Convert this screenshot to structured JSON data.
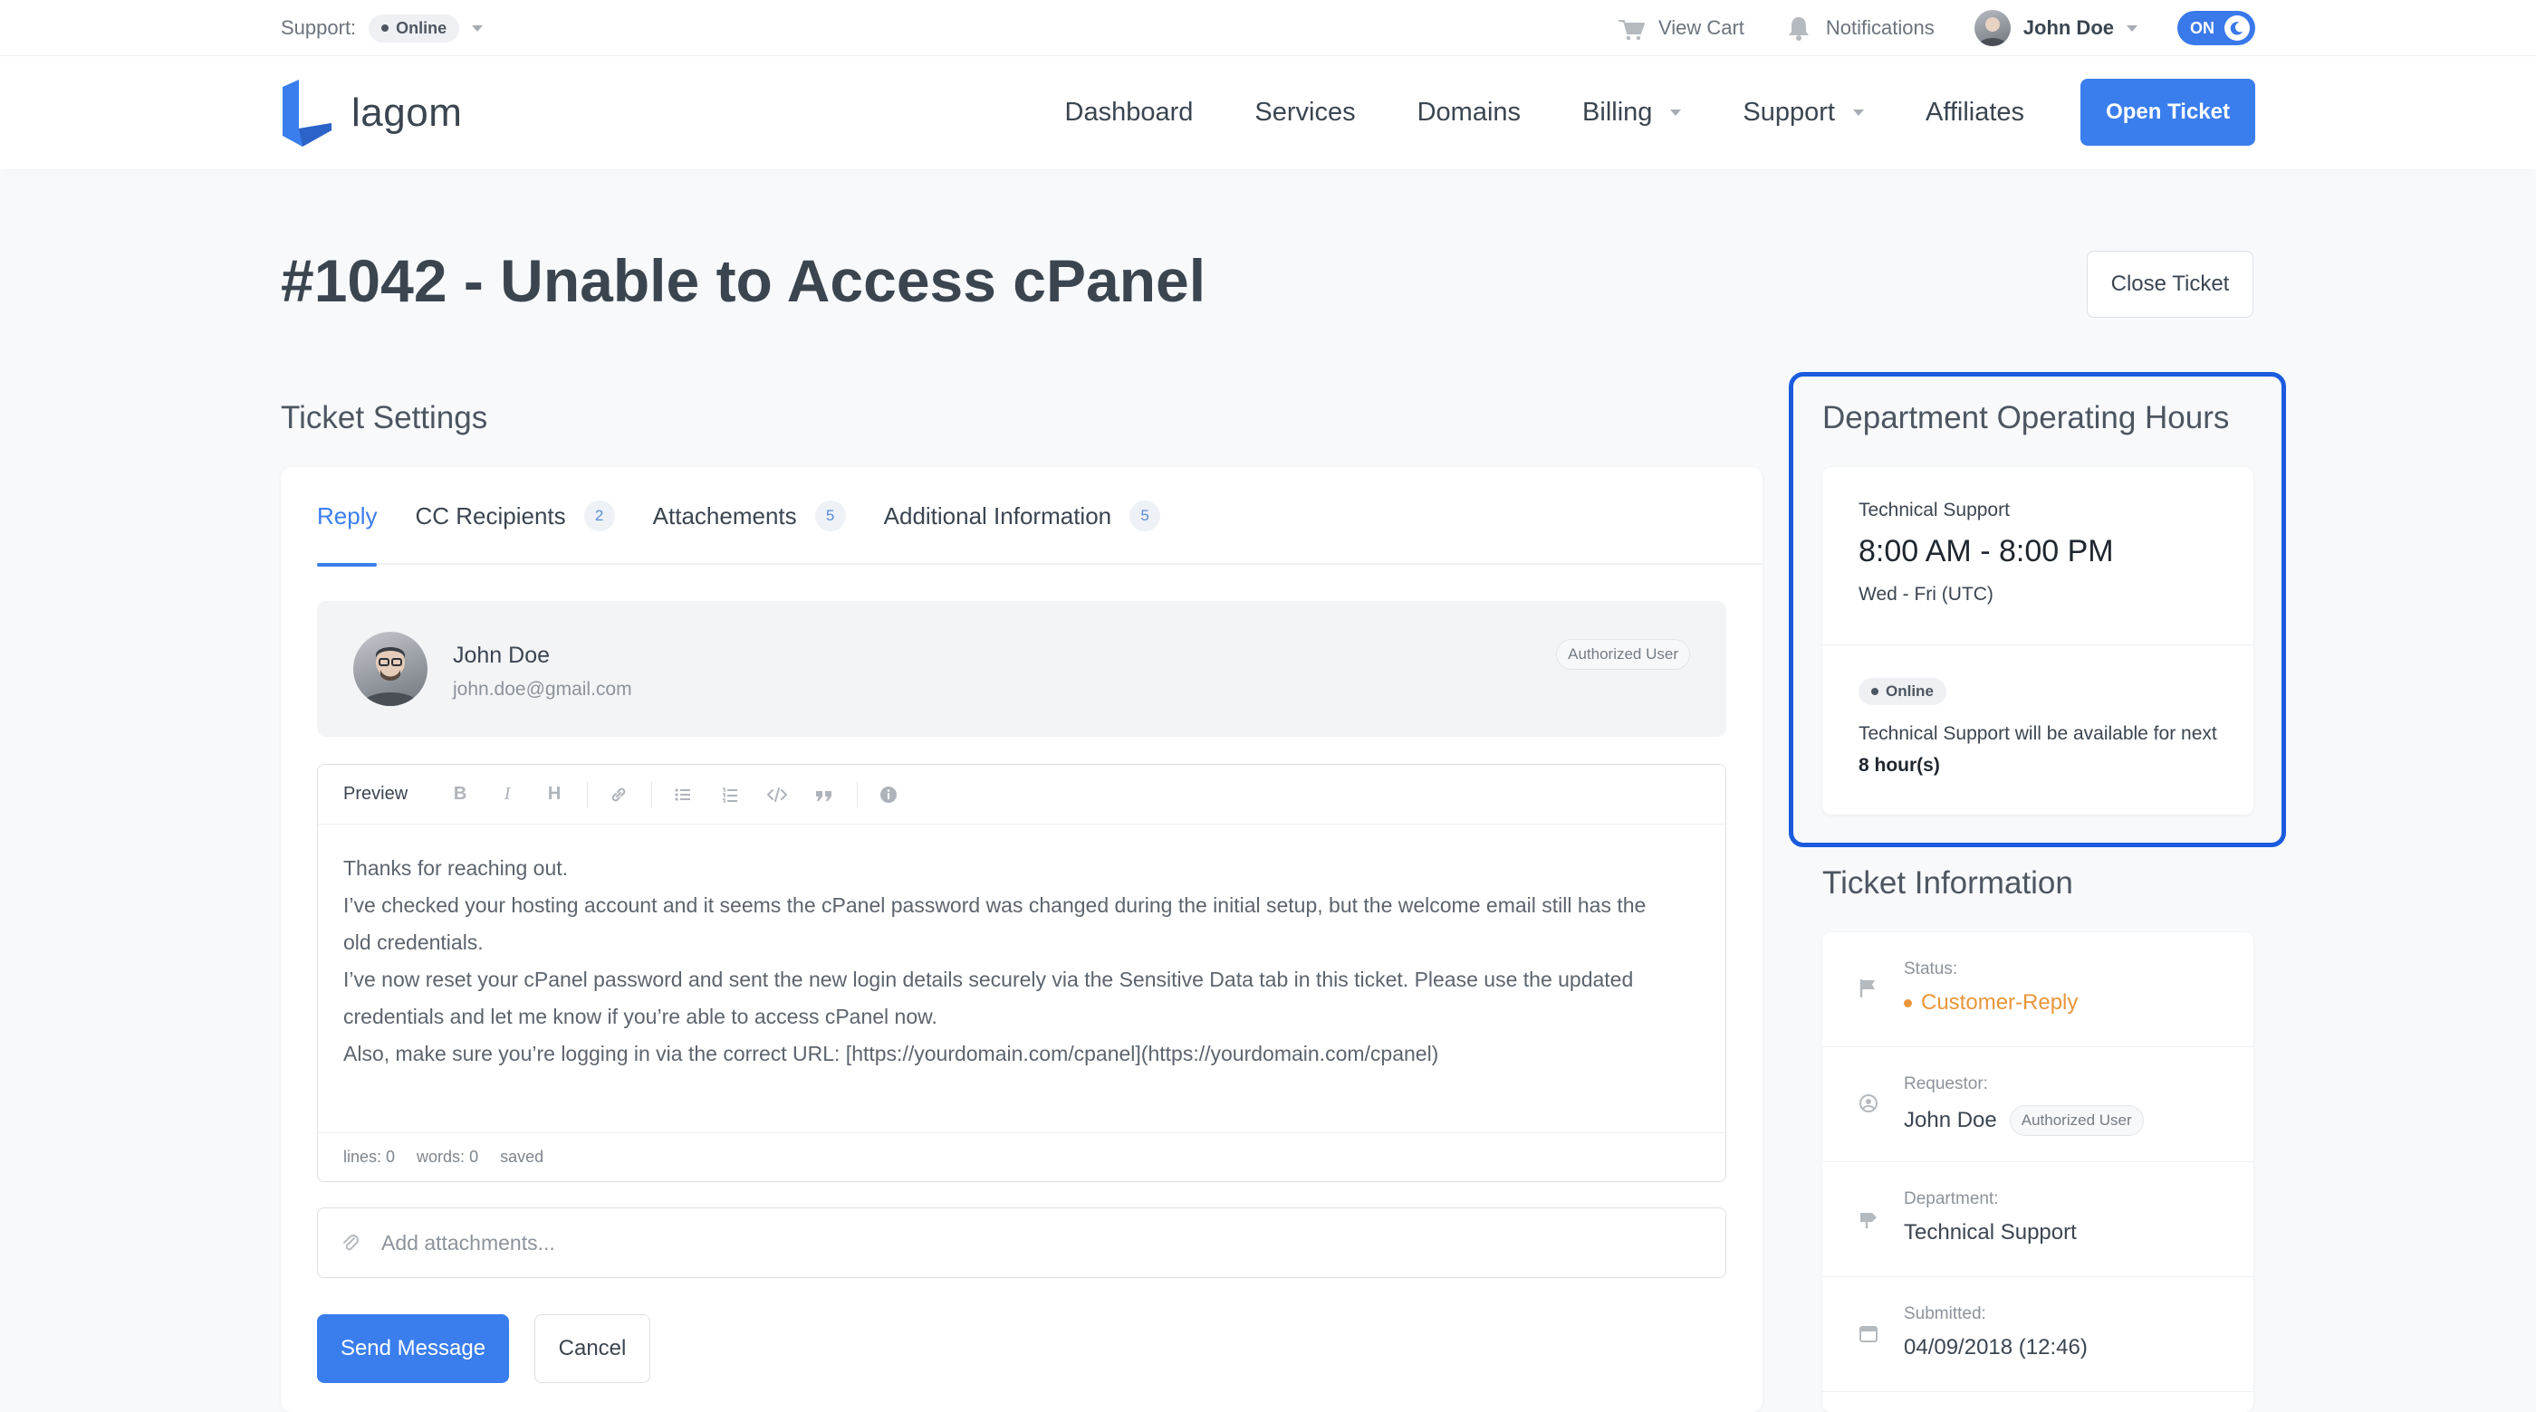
{
  "topbar": {
    "support_label": "Support:",
    "support_status": "Online",
    "view_cart": "View Cart",
    "notifications": "Notifications",
    "user_name": "John Doe",
    "toggle_label": "ON"
  },
  "nav": {
    "logo_text": "lagom",
    "items": [
      {
        "label": "Dashboard"
      },
      {
        "label": "Services"
      },
      {
        "label": "Domains"
      },
      {
        "label": "Billing"
      },
      {
        "label": "Support"
      },
      {
        "label": "Affiliates"
      }
    ],
    "open_ticket": "Open Ticket"
  },
  "page": {
    "title": "#1042 - Unable to Access cPanel",
    "close_ticket": "Close Ticket",
    "ticket_settings": "Ticket Settings"
  },
  "tabs": [
    {
      "label": "Reply"
    },
    {
      "label": "CC Recipients",
      "count": "2"
    },
    {
      "label": "Attachements",
      "count": "5"
    },
    {
      "label": "Additional Information",
      "count": "5"
    }
  ],
  "reply_user": {
    "name": "John Doe",
    "email": "john.doe@gmail.com",
    "role": "Authorized User"
  },
  "editor": {
    "preview_label": "Preview",
    "lines": [
      "Thanks for reaching out.",
      "I’ve checked your hosting account and it seems the cPanel password was changed during the initial setup, but the welcome email still has the",
      "old credentials.",
      "I’ve now reset your cPanel password and sent the new login details securely via the Sensitive Data tab in this ticket. Please use the updated",
      "credentials and let me know if you’re able to access cPanel now.",
      "Also, make sure you’re logging in via the correct URL: [https://yourdomain.com/cpanel](https://yourdomain.com/cpanel)"
    ],
    "status_lines": "lines: 0",
    "status_words": "words: 0",
    "status_saved": "saved"
  },
  "attachments": {
    "placeholder": "Add attachments..."
  },
  "actions": {
    "send": "Send Message",
    "cancel": "Cancel"
  },
  "hours": {
    "section_title": "Department Operating Hours",
    "department": "Technical Support",
    "time_range": "8:00 AM - 8:00 PM",
    "days": "Wed - Fri (UTC)",
    "status": "Online",
    "availability_text": "Technical Support will be available for next",
    "availability_hours": "8 hour(s)"
  },
  "ticket_info": {
    "section_title": "Ticket Information",
    "status_label": "Status:",
    "status_value": "Customer-Reply",
    "requestor_label": "Requestor:",
    "requestor_value": "John Doe",
    "requestor_role": "Authorized User",
    "department_label": "Department:",
    "department_value": "Technical Support",
    "submitted_label": "Submitted:",
    "submitted_value": "04/09/2018 (12:46)"
  },
  "colors": {
    "accent": "#3a7eee",
    "highlight_border": "#1b5bdd",
    "status_orange": "#e9963a"
  }
}
